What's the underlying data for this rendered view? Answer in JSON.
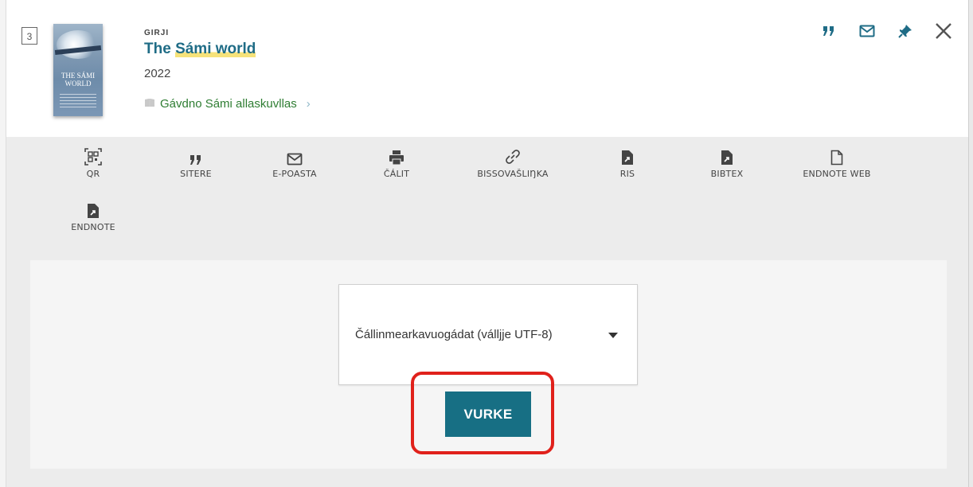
{
  "record": {
    "number": "3",
    "cover_text": "THE SÁMI WORLD",
    "type": "GIRJI",
    "title_prefix": "The ",
    "title_highlight": "Sámi world",
    "year": "2022",
    "series": "Gávdno Sámi allaskuvllas"
  },
  "top_actions": {
    "icons": [
      "quote-icon",
      "mail-icon",
      "pin-icon",
      "close-icon"
    ]
  },
  "tools": [
    {
      "label": "QR",
      "icon": "qr-icon"
    },
    {
      "label": "SITERE",
      "icon": "quote-icon"
    },
    {
      "label": "E-POASTA",
      "icon": "mail-icon"
    },
    {
      "label": "ČÁLIT",
      "icon": "print-icon"
    },
    {
      "label": "BISSOVAŠLIŊKA",
      "icon": "link-icon"
    },
    {
      "label": "RIS",
      "icon": "file-export-icon"
    },
    {
      "label": "BIBTEX",
      "icon": "file-export-icon"
    },
    {
      "label": "ENDNOTE WEB",
      "icon": "file-icon"
    },
    {
      "label": "ENDNOTE",
      "icon": "file-export-icon"
    }
  ],
  "export": {
    "encoding_select": "Čállinmearkavuogádat (válljje UTF-8)",
    "download_button": "VURKE"
  },
  "colors": {
    "accent": "#1f6c86",
    "button": "#176f84",
    "highlight": "#f6e27a",
    "annotation": "#e0211b",
    "series_link": "#2e7d32"
  }
}
